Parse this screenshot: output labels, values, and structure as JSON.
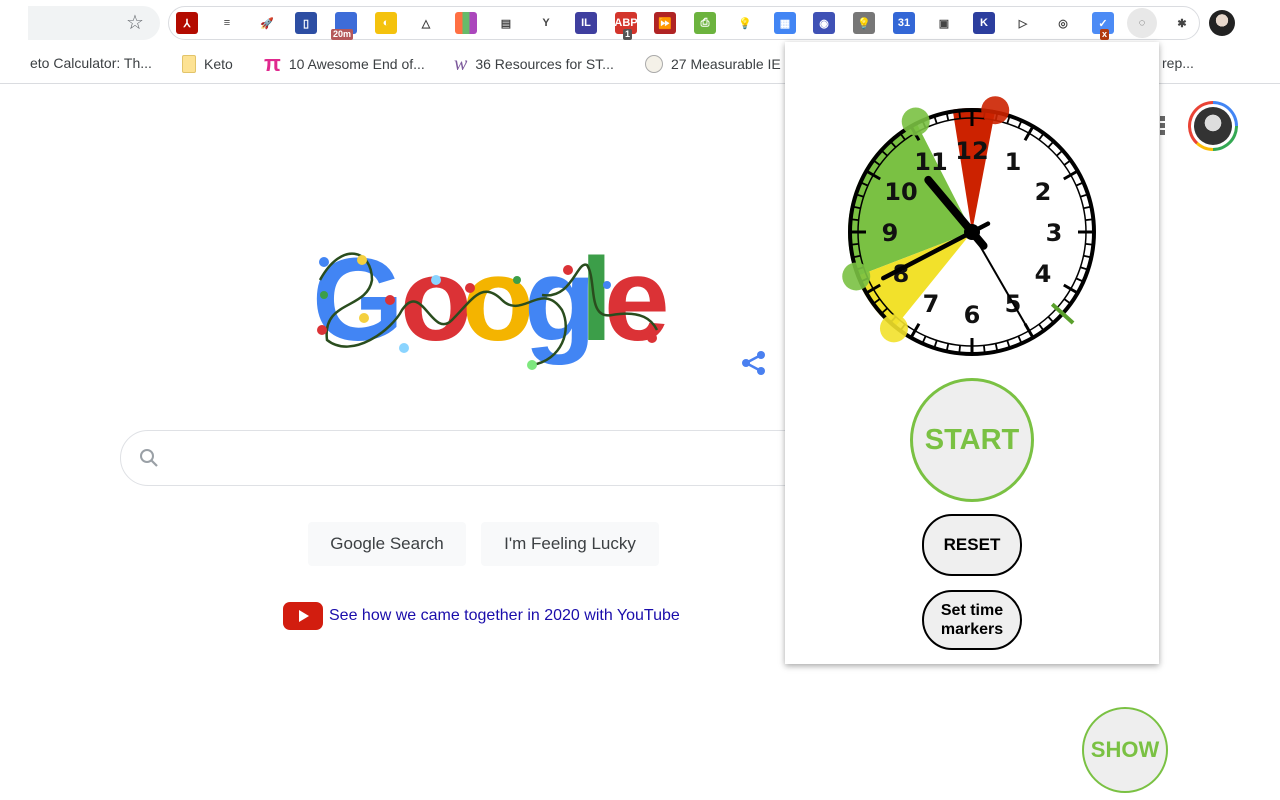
{
  "browser": {
    "extensions": [
      {
        "name": "adobe-acrobat",
        "color": "#b30b00",
        "glyph": "⅄"
      },
      {
        "name": "reader-view",
        "color": "#ffffff",
        "glyph": "≡"
      },
      {
        "name": "rocket",
        "color": "#ffffff",
        "glyph": "🚀"
      },
      {
        "name": "ebook",
        "color": "#2d4ea3",
        "glyph": "▯"
      },
      {
        "name": "timer-20m",
        "color": "#3d6cd8",
        "glyph": "",
        "badge": "20m",
        "badge_color": "#b5585a"
      },
      {
        "name": "color-pick",
        "color": "#f4c20d",
        "glyph": "◐"
      },
      {
        "name": "google-drive",
        "color": "#ffffff",
        "glyph": "△"
      },
      {
        "name": "color-grid",
        "color": "#ff7043",
        "glyph": ""
      },
      {
        "name": "text-view",
        "color": "#ffffff",
        "glyph": "▤"
      },
      {
        "name": "vimeo-like",
        "color": "#ffffff",
        "glyph": "Y"
      },
      {
        "name": "il",
        "color": "#3f3f9f",
        "glyph": "IL"
      },
      {
        "name": "adblock",
        "color": "#d3352c",
        "glyph": "ABP",
        "badge": "1",
        "badge_color": "#555555"
      },
      {
        "name": "fast-forward",
        "color": "#b02424",
        "glyph": "⏩"
      },
      {
        "name": "print-friendly",
        "color": "#6cb33e",
        "glyph": "⎙"
      },
      {
        "name": "lightbulb",
        "color": "#ffffff",
        "glyph": "💡"
      },
      {
        "name": "docs-stack",
        "color": "#4285f4",
        "glyph": "▦"
      },
      {
        "name": "screen-record",
        "color": "#3f51b5",
        "glyph": "◉"
      },
      {
        "name": "keep",
        "color": "#777777",
        "glyph": "💡"
      },
      {
        "name": "calendar",
        "color": "#3367d6",
        "glyph": "31"
      },
      {
        "name": "office",
        "color": "#ffffff",
        "glyph": "▣"
      },
      {
        "name": "kami",
        "color": "#2c3e9e",
        "glyph": "K"
      },
      {
        "name": "screencastify",
        "color": "#ffffff",
        "glyph": "▷"
      },
      {
        "name": "scan",
        "color": "#ffffff",
        "glyph": "◎"
      },
      {
        "name": "tasks",
        "color": "#4c8bf5",
        "glyph": "✓",
        "badge": "x",
        "badge_color": "#b23b0e"
      },
      {
        "name": "clock-timer",
        "color": "#e8e8e8",
        "glyph": "◌"
      },
      {
        "name": "extensions-puzzle",
        "color": "#ffffff",
        "glyph": "✱"
      }
    ],
    "bookmarks": [
      {
        "label": "eto Calculator: Th...",
        "icon": "none"
      },
      {
        "label": "Keto",
        "icon": "folder-icon"
      },
      {
        "label": "10 Awesome End of...",
        "icon": "pi-icon"
      },
      {
        "label": "36 Resources for ST...",
        "icon": "w-icon"
      },
      {
        "label": "27 Measurable IE",
        "icon": "circle-logo-icon"
      },
      {
        "label": "rep...",
        "icon": "none"
      }
    ]
  },
  "google": {
    "logo_letters": [
      {
        "ch": "G",
        "color": "#4285f4"
      },
      {
        "ch": "o",
        "color": "#db3236"
      },
      {
        "ch": "o",
        "color": "#f4b400"
      },
      {
        "ch": "g",
        "color": "#4285f4"
      },
      {
        "ch": "l",
        "color": "#3c9e49"
      },
      {
        "ch": "e",
        "color": "#db3236"
      }
    ],
    "search_placeholder": "",
    "search_button": "Google Search",
    "lucky_button": "I'm Feeling Lucky",
    "promo_link": "See how we came together in 2020 with YouTube"
  },
  "timer_popup": {
    "clock": {
      "hour_numbers": [
        "12",
        "1",
        "2",
        "3",
        "4",
        "5",
        "6",
        "7",
        "8",
        "9",
        "10",
        "11"
      ],
      "time": {
        "hours": 10,
        "minutes": 40,
        "seconds": 25
      },
      "sectors_minutes": [
        {
          "name": "red-sector",
          "from": 58.5,
          "to": 1.8,
          "color": "#cc2200"
        },
        {
          "name": "green-sector",
          "from": 41.5,
          "to": 55.5,
          "color": "#7ac143"
        },
        {
          "name": "yellow-sector",
          "from": 36.5,
          "to": 41.5,
          "color": "#f2e12b"
        }
      ],
      "marker_minute": 22,
      "marker_color": "#5aa02c"
    },
    "start_label": "START",
    "reset_label": "RESET",
    "set_markers_label": "Set time markers",
    "accent_color": "#7ac143"
  },
  "show_label": "SHOW"
}
